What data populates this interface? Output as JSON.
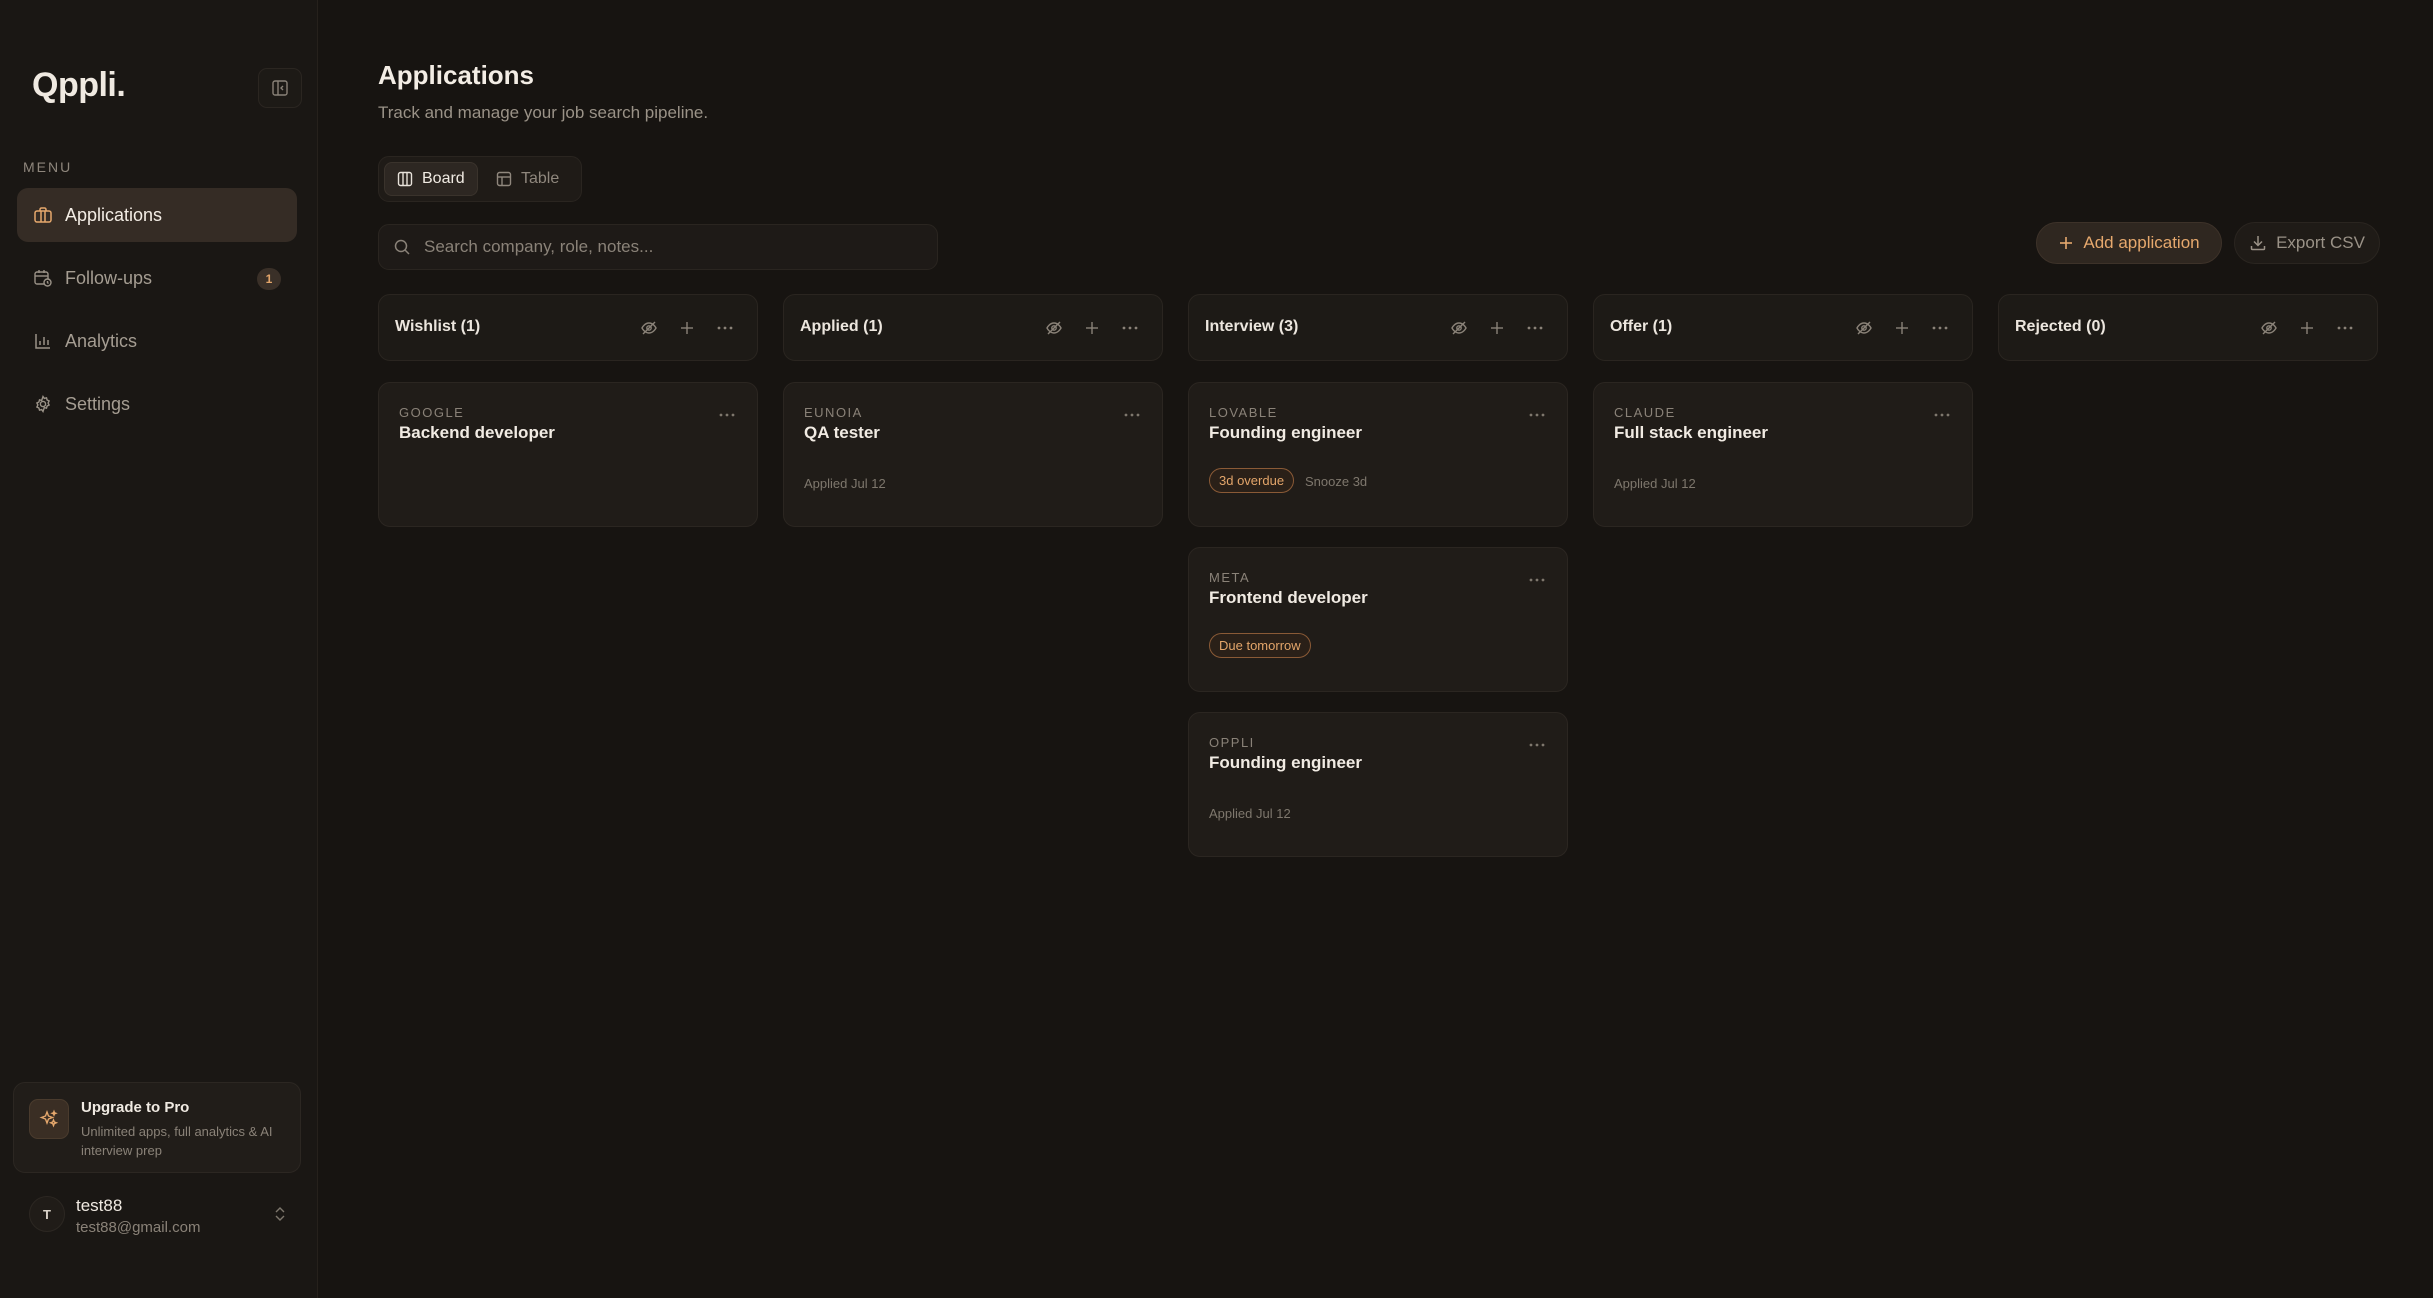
{
  "app": {
    "logo": "Qppli."
  },
  "sidebar": {
    "menu_label": "MENU",
    "items": [
      {
        "label": "Applications",
        "icon": "briefcase-icon",
        "active": true
      },
      {
        "label": "Follow-ups",
        "icon": "calendar-clock-icon",
        "badge": "1"
      },
      {
        "label": "Analytics",
        "icon": "bar-chart-icon"
      },
      {
        "label": "Settings",
        "icon": "gear-icon"
      }
    ],
    "upgrade": {
      "title": "Upgrade to Pro",
      "description": "Unlimited apps, full analytics & AI interview prep"
    },
    "user": {
      "initial": "T",
      "name": "test88",
      "email": "test88@gmail.com"
    }
  },
  "header": {
    "title": "Applications",
    "subtitle": "Track and manage your job search pipeline."
  },
  "view_toggle": {
    "board": "Board",
    "table": "Table",
    "active": "board"
  },
  "search": {
    "placeholder": "Search company, role, notes..."
  },
  "actions": {
    "add": "Add application",
    "export": "Export CSV"
  },
  "colors": {
    "accent": "#e6a86d",
    "background": "#171411",
    "card": "#201c18"
  },
  "columns": [
    {
      "title": "Wishlist (1)",
      "cards": [
        {
          "company": "GOOGLE",
          "role": "Backend developer"
        }
      ]
    },
    {
      "title": "Applied (1)",
      "cards": [
        {
          "company": "EUNOIA",
          "role": "QA tester",
          "meta": "Applied Jul 12"
        }
      ]
    },
    {
      "title": "Interview (3)",
      "cards": [
        {
          "company": "LOVABLE",
          "role": "Founding engineer",
          "tag": "3d overdue",
          "snooze": "Snooze 3d"
        },
        {
          "company": "META",
          "role": "Frontend developer",
          "tag": "Due tomorrow"
        },
        {
          "company": "OPPLI",
          "role": "Founding engineer",
          "meta": "Applied Jul 12"
        }
      ]
    },
    {
      "title": "Offer (1)",
      "cards": [
        {
          "company": "CLAUDE",
          "role": "Full stack engineer",
          "meta": "Applied Jul 12"
        }
      ]
    },
    {
      "title": "Rejected (0)",
      "cards": []
    }
  ]
}
